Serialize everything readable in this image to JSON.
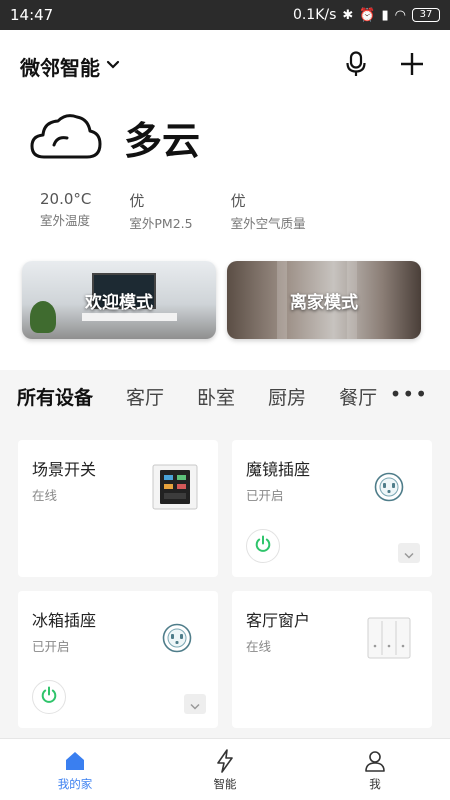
{
  "status_bar": {
    "time": "14:47",
    "net_speed": "0.1K/s",
    "battery": "37"
  },
  "header": {
    "home_name": "微邻智能"
  },
  "weather": {
    "condition": "多云",
    "metrics": [
      {
        "value": "20.0°C",
        "label": "室外温度"
      },
      {
        "value": "优",
        "label": "室外PM2.5"
      },
      {
        "value": "优",
        "label": "室外空气质量"
      }
    ]
  },
  "scenes": [
    {
      "label": "欢迎模式"
    },
    {
      "label": "离家模式"
    }
  ],
  "tabs": [
    {
      "label": "所有设备",
      "active": true
    },
    {
      "label": "客厅"
    },
    {
      "label": "卧室"
    },
    {
      "label": "厨房"
    },
    {
      "label": "餐厅"
    }
  ],
  "devices": [
    {
      "name": "场景开关",
      "status": "在线",
      "icon": "scene-switch-icon"
    },
    {
      "name": "魔镜插座",
      "status": "已开启",
      "icon": "socket-icon"
    },
    {
      "name": "冰箱插座",
      "status": "已开启",
      "icon": "socket-icon"
    },
    {
      "name": "客厅窗户",
      "status": "在线",
      "icon": "curtain-switch-icon"
    }
  ],
  "bottom_nav": [
    {
      "label": "我的家",
      "icon": "home-icon",
      "active": true
    },
    {
      "label": "智能",
      "icon": "lightning-icon"
    },
    {
      "label": "我",
      "icon": "user-icon"
    }
  ],
  "colors": {
    "accent": "#3a7ff0",
    "power_on": "#2fc46b",
    "status_bar": "#2b2b2b"
  }
}
